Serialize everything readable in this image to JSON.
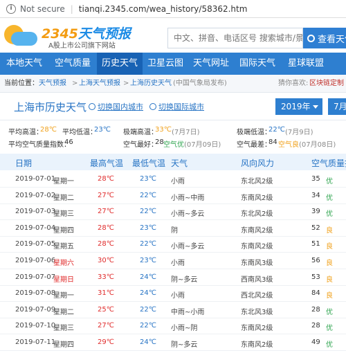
{
  "browser": {
    "security_text": "Not secure",
    "url": "tianqi.2345.com/wea_history/58362.htm"
  },
  "header": {
    "brand_num": "2345",
    "brand_text": "天气预报",
    "tagline": "A股上市公司旗下网站",
    "search_placeholder": "中文、拼音、电话区号 搜索城市/景点",
    "search_button": "查看天气"
  },
  "nav": {
    "items": [
      "本地天气",
      "空气质量",
      "历史天气",
      "卫星云图",
      "天气网址",
      "国际天气",
      "星球联盟"
    ],
    "active_index": 2
  },
  "breadcrumb": {
    "prefix": "当前位置：",
    "items": [
      "天气预报",
      "上海天气预报",
      "上海历史天气"
    ],
    "note": "(中国气象局发布)",
    "recommend_label": "猜你喜欢:",
    "recommend_link": "区块链定制"
  },
  "title_row": {
    "title": "上海市历史天气",
    "switch_domestic": "切换国内城市",
    "switch_intl": "切换国际城市",
    "year": "2019年",
    "month": "7月"
  },
  "stats": {
    "avg_high_label": "平均高温：",
    "avg_high": "28℃",
    "avg_low_label": "平均低温：",
    "avg_low": "23℃",
    "max_high_label": "极端高温：",
    "max_high": "33℃",
    "max_high_date": "(7月7日)",
    "min_low_label": "极端低温：",
    "min_low": "22℃",
    "min_low_date": "(7月9日)",
    "avg_aqi_label": "平均空气质量指数：",
    "avg_aqi": "46",
    "best_label": "空气最好：",
    "best_value": "28",
    "best_level": "空气优",
    "best_date": "(07月09日)",
    "worst_label": "空气最差：",
    "worst_value": "84",
    "worst_level": "空气良",
    "worst_date": "(07月08日)"
  },
  "table": {
    "headers": [
      "日期",
      "最高气温",
      "最低气温",
      "天气",
      "风向风力",
      "空气质量指"
    ],
    "rows": [
      {
        "date": "2019-07-01",
        "week": "星期一",
        "high": "28℃",
        "low": "23℃",
        "weather": "小雨",
        "wind": "东北风2级",
        "aqi": "35",
        "level": "优"
      },
      {
        "date": "2019-07-02",
        "week": "星期二",
        "high": "27℃",
        "low": "22℃",
        "weather": "小雨~中雨",
        "wind": "东南风2级",
        "aqi": "34",
        "level": "优"
      },
      {
        "date": "2019-07-03",
        "week": "星期三",
        "high": "27℃",
        "low": "22℃",
        "weather": "小雨~多云",
        "wind": "东北风2级",
        "aqi": "39",
        "level": "优"
      },
      {
        "date": "2019-07-04",
        "week": "星期四",
        "high": "28℃",
        "low": "23℃",
        "weather": "阴",
        "wind": "东南风2级",
        "aqi": "52",
        "level": "良"
      },
      {
        "date": "2019-07-05",
        "week": "星期五",
        "high": "28℃",
        "low": "22℃",
        "weather": "小雨~多云",
        "wind": "东南风2级",
        "aqi": "51",
        "level": "良"
      },
      {
        "date": "2019-07-06",
        "week": "星期六",
        "high": "30℃",
        "low": "23℃",
        "weather": "小雨",
        "wind": "东南风3级",
        "aqi": "56",
        "level": "良"
      },
      {
        "date": "2019-07-07",
        "week": "星期日",
        "high": "33℃",
        "low": "24℃",
        "weather": "阴~多云",
        "wind": "西南风3级",
        "aqi": "53",
        "level": "良"
      },
      {
        "date": "2019-07-08",
        "week": "星期一",
        "high": "31℃",
        "low": "24℃",
        "weather": "小雨",
        "wind": "西北风2级",
        "aqi": "84",
        "level": "良"
      },
      {
        "date": "2019-07-09",
        "week": "星期二",
        "high": "25℃",
        "low": "22℃",
        "weather": "中雨~小雨",
        "wind": "东北风3级",
        "aqi": "28",
        "level": "优"
      },
      {
        "date": "2019-07-10",
        "week": "星期三",
        "high": "27℃",
        "low": "22℃",
        "weather": "小雨~阴",
        "wind": "东南风2级",
        "aqi": "28",
        "level": "优"
      },
      {
        "date": "2019-07-11",
        "week": "星期四",
        "high": "29℃",
        "low": "24℃",
        "weather": "阴~多云",
        "wind": "东南风2级",
        "aqi": "49",
        "level": "优"
      }
    ]
  },
  "colors": {
    "nav_bg": "#2e7fd0",
    "nav_active": "#1862b4",
    "link": "#2673c4",
    "orange": "#f0a11c",
    "green": "#2da44e",
    "red": "#e02b2b"
  }
}
